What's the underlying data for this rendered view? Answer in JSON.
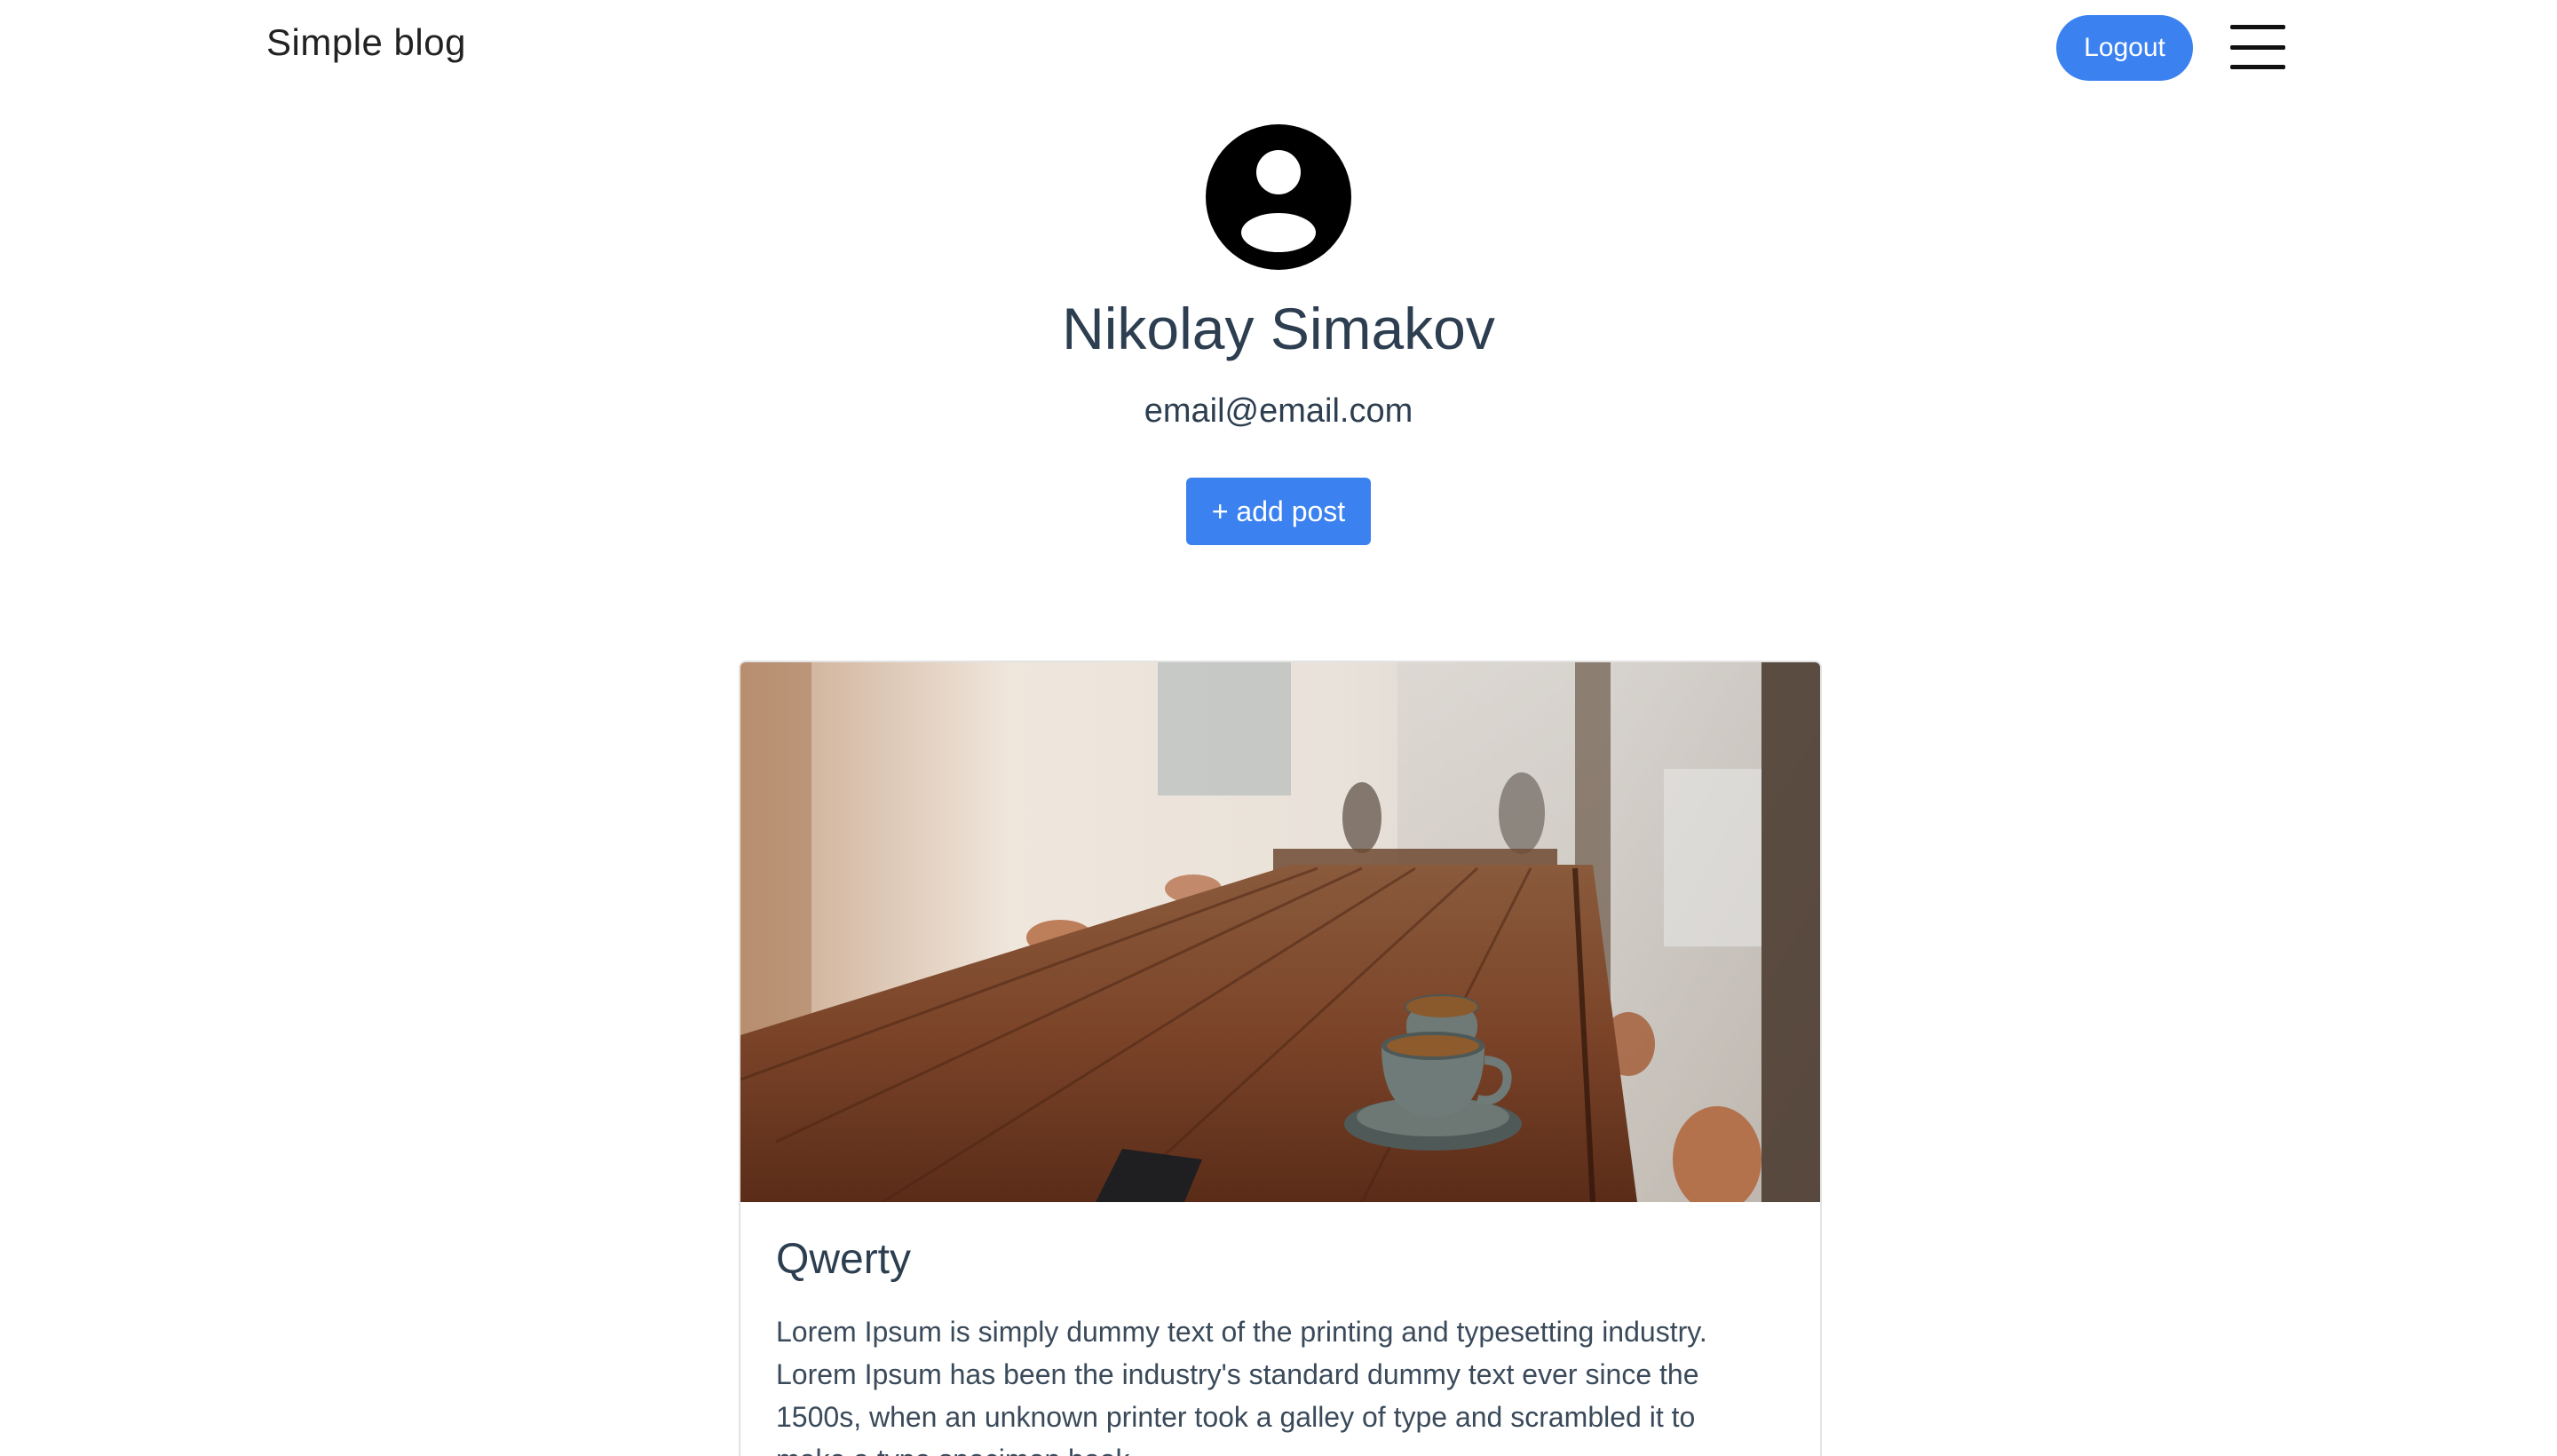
{
  "header": {
    "brand": "Simple blog",
    "logout_label": "Logout",
    "menu_icon": "hamburger-menu-icon"
  },
  "profile": {
    "avatar_icon": "user-avatar-icon",
    "name": "Nikolay Simakov",
    "email": "email@email.com",
    "add_post_label": "+ add post"
  },
  "posts": [
    {
      "image_alt": "Coffee cups on a wooden cafe table",
      "title": "Qwerty",
      "excerpt": "Lorem Ipsum is simply dummy text of the printing and typesetting industry. Lorem Ipsum has been the industry's standard dummy text ever since the 1500s, when an unknown printer took a galley of type and scrambled it to make a type specimen book."
    }
  ],
  "colors": {
    "accent": "#3b82f0",
    "text": "#2c3e50"
  }
}
